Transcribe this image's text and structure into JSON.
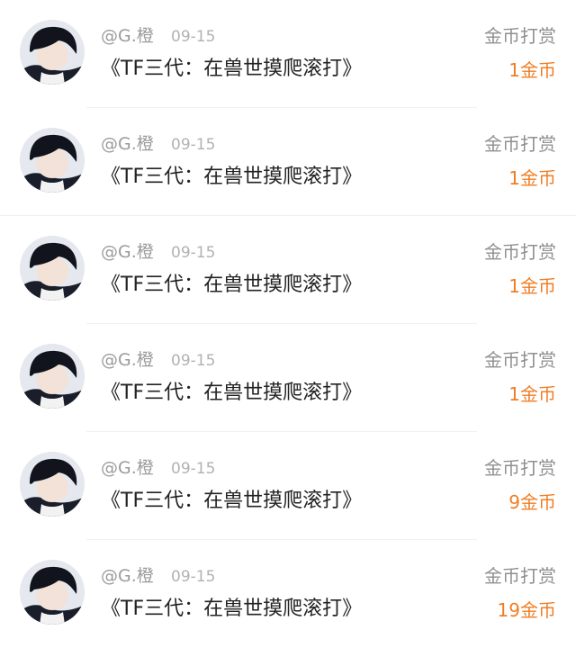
{
  "items": [
    {
      "username": "@G.橙",
      "date": "09-15",
      "title": "《TF三代：在兽世摸爬滚打》",
      "action": "金币打赏",
      "amount": "1金币"
    },
    {
      "username": "@G.橙",
      "date": "09-15",
      "title": "《TF三代：在兽世摸爬滚打》",
      "action": "金币打赏",
      "amount": "1金币"
    },
    {
      "username": "@G.橙",
      "date": "09-15",
      "title": "《TF三代：在兽世摸爬滚打》",
      "action": "金币打赏",
      "amount": "1金币"
    },
    {
      "username": "@G.橙",
      "date": "09-15",
      "title": "《TF三代：在兽世摸爬滚打》",
      "action": "金币打赏",
      "amount": "1金币"
    },
    {
      "username": "@G.橙",
      "date": "09-15",
      "title": "《TF三代：在兽世摸爬滚打》",
      "action": "金币打赏",
      "amount": "9金币"
    },
    {
      "username": "@G.橙",
      "date": "09-15",
      "title": "《TF三代：在兽世摸爬滚打》",
      "action": "金币打赏",
      "amount": "19金币"
    }
  ],
  "colors": {
    "amount": "#f07d24",
    "username": "#9b9b9b",
    "date": "#b2b2b2",
    "title": "#222222",
    "action": "#8f8f8f"
  }
}
